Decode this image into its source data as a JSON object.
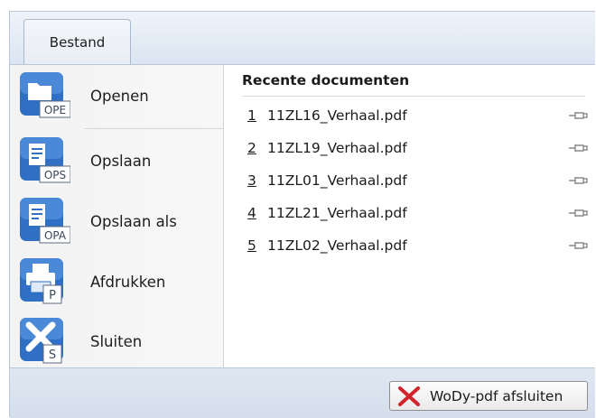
{
  "tab": {
    "label": "Bestand"
  },
  "commands": [
    {
      "label": "Openen",
      "badge": "OPE",
      "icon": "folder-open-icon"
    },
    {
      "label": "Opslaan",
      "badge": "OPS",
      "icon": "save-document-icon"
    },
    {
      "label": "Opslaan als",
      "badge": "OPA",
      "icon": "save-as-document-icon"
    },
    {
      "label": "Afdrukken",
      "badge": "P",
      "icon": "printer-icon"
    },
    {
      "label": "Sluiten",
      "badge": "S",
      "icon": "close-document-icon"
    }
  ],
  "recent": {
    "title": "Recente documenten",
    "items": [
      {
        "num": "1",
        "name": "11ZL16_Verhaal.pdf"
      },
      {
        "num": "2",
        "name": "11ZL19_Verhaal.pdf"
      },
      {
        "num": "3",
        "name": "11ZL01_Verhaal.pdf"
      },
      {
        "num": "4",
        "name": "11ZL21_Verhaal.pdf"
      },
      {
        "num": "5",
        "name": "11ZL02_Verhaal.pdf"
      }
    ]
  },
  "footer": {
    "exit_label": "WoDy-pdf afsluiten"
  },
  "colors": {
    "icon_blue": "#2f6fc4",
    "exit_red": "#d2232a"
  }
}
